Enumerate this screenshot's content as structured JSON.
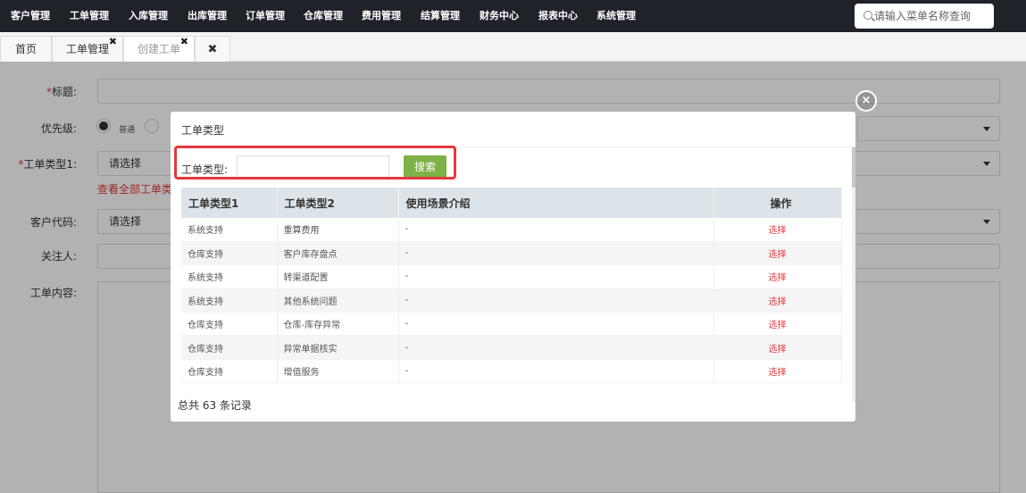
{
  "nav": {
    "items": [
      "客户管理",
      "工单管理",
      "入库管理",
      "出库管理",
      "订单管理",
      "仓库管理",
      "费用管理",
      "结算管理",
      "财务中心",
      "报表中心",
      "系统管理"
    ],
    "search_placeholder": "请输入菜单名称查询"
  },
  "tabs": {
    "home": "首页",
    "workorder": "工单管理",
    "create": "创建工单",
    "close_glyph": "✖"
  },
  "form": {
    "title_label": "标题:",
    "priority_label": "优先级:",
    "priority_normal": "普通",
    "type1_label": "工单类型1:",
    "type1_value": "请选择",
    "view_all_link": "查看全部工单类型",
    "customer_label": "客户代码:",
    "customer_value": "请选择",
    "follower_label": "关注人:",
    "content_label": "工单内容:",
    "required_mark": "*"
  },
  "modal": {
    "title": "工单类型",
    "search_label": "工单类型:",
    "search_value": "",
    "search_button": "搜索",
    "columns": [
      "工单类型1",
      "工单类型2",
      "使用场景介绍",
      "操作"
    ],
    "rows": [
      {
        "type1": "系统支持",
        "type2": "重算费用",
        "desc": "-",
        "action": "选择"
      },
      {
        "type1": "仓库支持",
        "type2": "客户库存盘点",
        "desc": "-",
        "action": "选择"
      },
      {
        "type1": "系统支持",
        "type2": "转渠道配置",
        "desc": "-",
        "action": "选择"
      },
      {
        "type1": "系统支持",
        "type2": "其他系统问题",
        "desc": "-",
        "action": "选择"
      },
      {
        "type1": "仓库支持",
        "type2": "仓库-库存异常",
        "desc": "-",
        "action": "选择"
      },
      {
        "type1": "仓库支持",
        "type2": "异常单据核实",
        "desc": "-",
        "action": "选择"
      },
      {
        "type1": "仓库支持",
        "type2": "增值服务",
        "desc": "-",
        "action": "选择"
      }
    ],
    "total": "总共 63 条记录",
    "close_glyph": "×"
  },
  "colors": {
    "nav_bg": "#1f2229",
    "search_btn": "#7eb146",
    "highlight": "#e4393c",
    "header_row": "#dce4ea"
  }
}
